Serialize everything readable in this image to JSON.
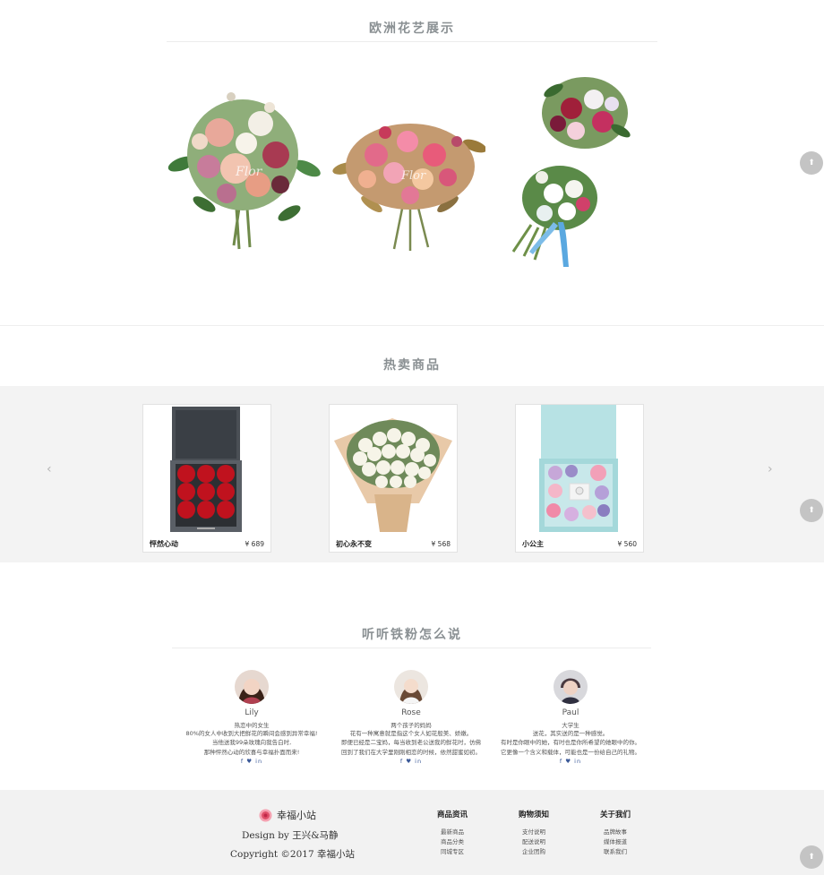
{
  "gallery": {
    "title": "欧洲花艺展示",
    "watermark": "Flor"
  },
  "hot": {
    "title": "热卖商品",
    "products": [
      {
        "name": "怦然心动",
        "price": "¥ 689"
      },
      {
        "name": "初心永不变",
        "price": "¥ 568"
      },
      {
        "name": "小公主",
        "price": "¥ 560"
      }
    ],
    "prev_arrow": "‹",
    "next_arrow": "›"
  },
  "fans": {
    "title": "听听铁粉怎么说",
    "items": [
      {
        "name": "Lily",
        "role": "热恋中的女生",
        "lines": [
          "80%的女人中收到大把鲜花的瞬间会感到异常幸福!",
          "当他送我99朵玫瑰向我告白时,",
          "那种怦然心动的欣喜与幸福扑面而来!"
        ],
        "social": "f ♥ in"
      },
      {
        "name": "Rose",
        "role": "两个孩子的妈妈",
        "lines": [
          "花有一种寓意就是指这个女人如花般美、娇嫩。",
          "即便已经是二宝妈，每当收到老公送我的鲜花时，仿佛",
          "回到了我们在大学里刚刚相恋的时候，依然甜蜜如初。"
        ],
        "social": "f ♥ in"
      },
      {
        "name": "Paul",
        "role": "大学生",
        "lines": [
          "送花，其实送的是一种感觉。",
          "有时是你眼中的她，有时也是你所希望的她眼中的你。",
          "它更像一个含义和载体，可能也是一份给自己的礼物。"
        ],
        "social": "f ♥ in"
      }
    ]
  },
  "footer": {
    "brand": "幸福小站",
    "design": "Design by 王兴&马静",
    "copyright": "Copyright ©2017 幸福小站",
    "columns": [
      {
        "title": "商品资讯",
        "links": [
          "最新商品",
          "商品分类",
          "同城专区"
        ]
      },
      {
        "title": "购物须知",
        "links": [
          "支付说明",
          "配送说明",
          "企业团购"
        ]
      },
      {
        "title": "关于我们",
        "links": [
          "品牌故事",
          "媒体报道",
          "联系我们"
        ]
      }
    ]
  },
  "back_to_top": "⬆",
  "colors": {
    "accent_brand": "#e0506a",
    "band_bg": "#f3f3f3",
    "title_gray": "#8a9093"
  }
}
